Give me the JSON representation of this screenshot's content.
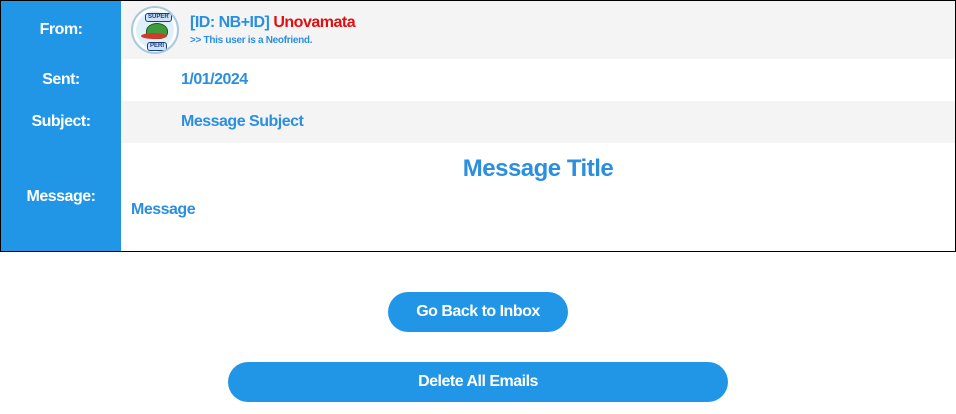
{
  "labels": {
    "from": "From:",
    "sent": "Sent:",
    "subject": "Subject:",
    "message": "Message:"
  },
  "from": {
    "avatar": {
      "icon": "super-peri-avatar-icon",
      "badge_top": "SUPER",
      "badge_bottom": "PERI"
    },
    "id_tag": "[ID: NB+ID]",
    "username": "Unovamata",
    "note": ">> This user is a Neofriend."
  },
  "sent": "1/01/2024",
  "subject": "Message Subject",
  "message": {
    "title": "Message Title",
    "body": "Message"
  },
  "buttons": {
    "back": "Go Back to Inbox",
    "delete": "Delete All Emails"
  },
  "colors": {
    "accent": "#2196e7",
    "text_blue": "#2b8fe0",
    "username_red": "#e01010",
    "row_grey": "#f4f4f4"
  }
}
